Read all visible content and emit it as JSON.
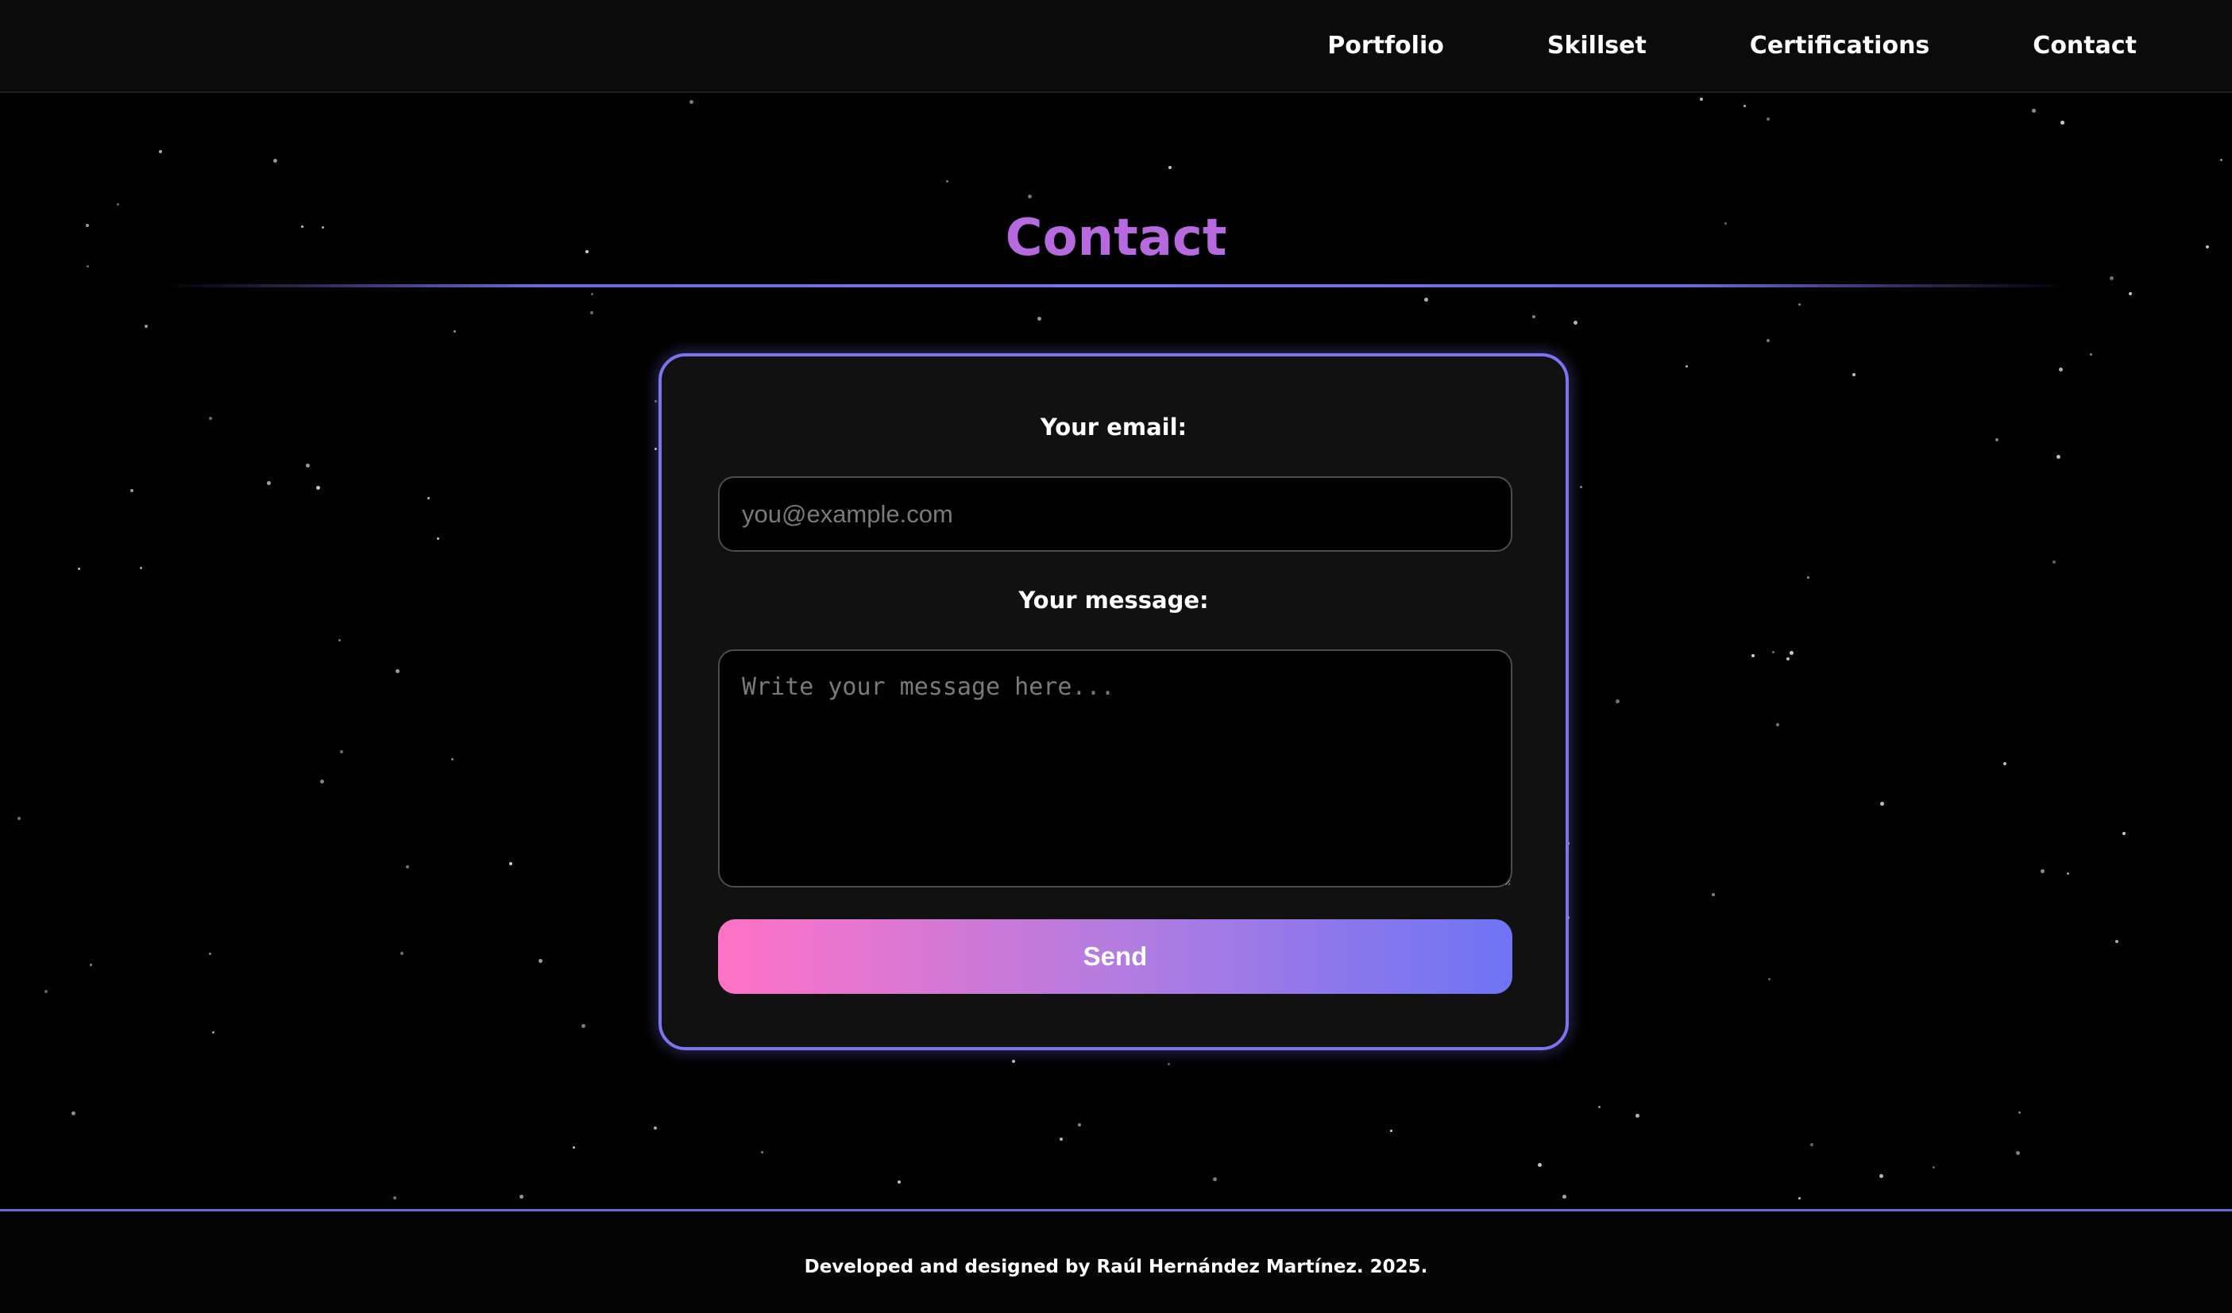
{
  "navbar": {
    "items": [
      {
        "label": "Portfolio"
      },
      {
        "label": "Skillset"
      },
      {
        "label": "Certifications"
      },
      {
        "label": "Contact"
      }
    ]
  },
  "main": {
    "title": "Contact"
  },
  "form": {
    "email_label": "Your email:",
    "email_value": "",
    "email_placeholder": "you@example.com",
    "message_label": "Your message:",
    "message_value": "",
    "message_placeholder": "Write your message here...",
    "send_label": "Send"
  },
  "footer": {
    "text": "Developed and designed by Raúl Hernández Martínez. 2025."
  },
  "colors": {
    "background": "#000000",
    "accent": "#7c74f0",
    "title": "#b76ae0",
    "card": "#111111",
    "button_gradient_start": "#ff72c6",
    "button_gradient_end": "#6e74f4"
  }
}
